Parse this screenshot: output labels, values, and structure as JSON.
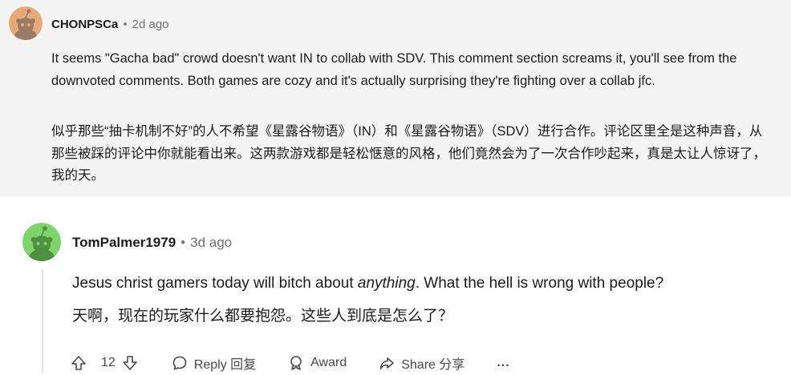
{
  "comment1": {
    "username": "CHONPSCa",
    "separator": "•",
    "age": "2d ago",
    "text_en": "It seems \"Gacha bad\" crowd doesn't want IN to collab with SDV. This comment section screams it, you'll see from the downvoted comments. Both games are cozy and it's actually surprising they're fighting over a collab jfc.",
    "text_zh": "似乎那些“抽卡机制不好”的人不希望《星露谷物语》（IN）和《星露谷物语》（SDV）进行合作。评论区里全是这种声音，从那些被踩的评论中你就能看出来。这两款游戏都是轻松惬意的风格，他们竟然会为了一次合作吵起来，真是太让人惊讶了，我的天。",
    "avatar_color": "#e8a979"
  },
  "comment2": {
    "username": "TomPalmer1979",
    "separator": "•",
    "age": "3d ago",
    "text_en_before": "Jesus christ gamers today will bitch about ",
    "text_en_italic": "anything",
    "text_en_after": ". What the hell is wrong with people?",
    "text_zh": "天啊，现在的玩家什么都要抱怨。这些人到底是怎么了？",
    "avatar_color": "#7ed36b",
    "actions": {
      "upvote_icon": "upvote-arrow-icon",
      "vote_count": "12",
      "downvote_icon": "downvote-arrow-icon",
      "reply_label": "Reply 回复",
      "award_label": "Award",
      "share_label": "Share 分享",
      "more_label": "..."
    }
  }
}
